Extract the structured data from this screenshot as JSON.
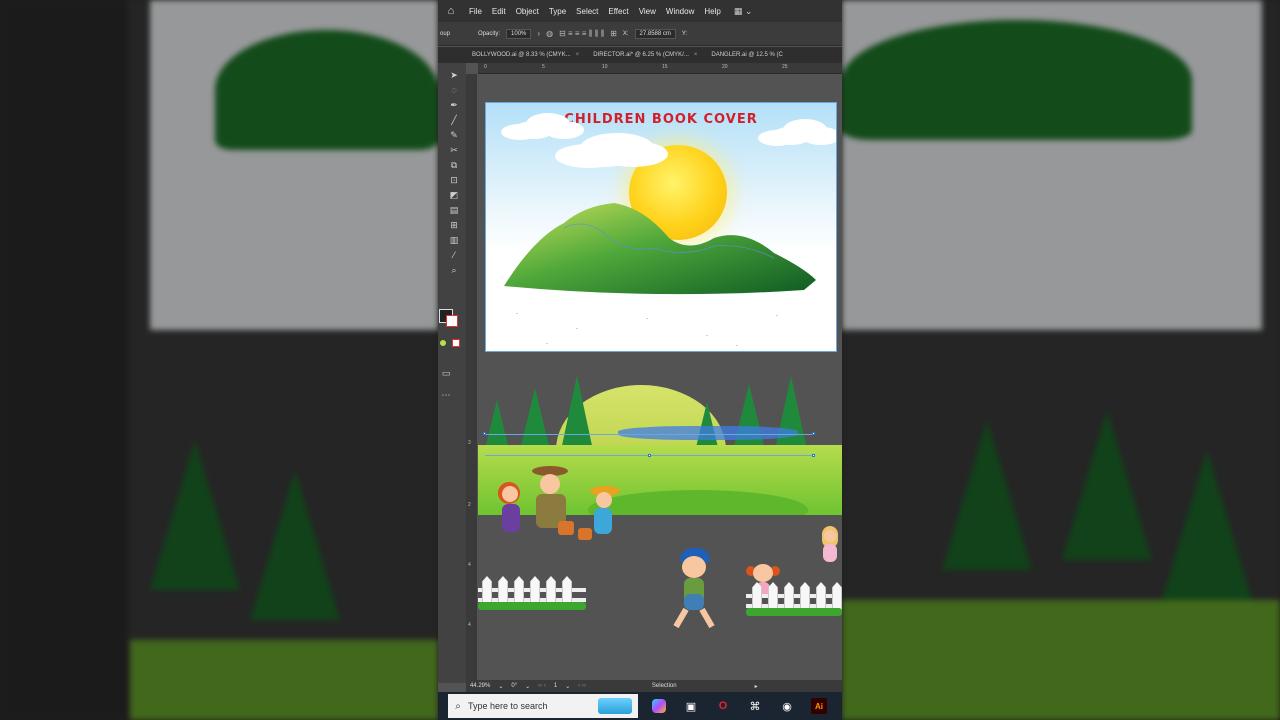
{
  "menu": {
    "items": [
      "File",
      "Edit",
      "Object",
      "Type",
      "Select",
      "Effect",
      "View",
      "Window",
      "Help"
    ]
  },
  "control_bar": {
    "group_label": "oup",
    "opacity_label": "Opacity:",
    "opacity_value": "100%",
    "x_value": "27.8588 cm",
    "x_label": "X:",
    "y_label": "Y:"
  },
  "tabs": [
    {
      "label": "BOLLYWOOD.ai @ 8.33 % (CMYK..."
    },
    {
      "label": "DIRECTOR.ai* @ 6.25 % (CMYK/..."
    },
    {
      "label": "DANGLER.ai @ 12.5 % (C"
    }
  ],
  "ruler": {
    "h_ticks": [
      "0",
      "5",
      "10",
      "15",
      "20",
      "25"
    ],
    "v_ticks": [
      "3",
      "2",
      "4",
      "4"
    ]
  },
  "artboard": {
    "title": "CHILDREN BOOK COVER"
  },
  "statusbar": {
    "zoom": "44.29%",
    "rotation": "0°",
    "page": "1",
    "tool": "Selection"
  },
  "taskbar": {
    "search_placeholder": "Type here to search"
  },
  "colors": {
    "title_red": "#d31f2a",
    "selection_blue": "#6aa7e0",
    "grass_green": "#6fc331",
    "ui_dark": "#323232"
  }
}
